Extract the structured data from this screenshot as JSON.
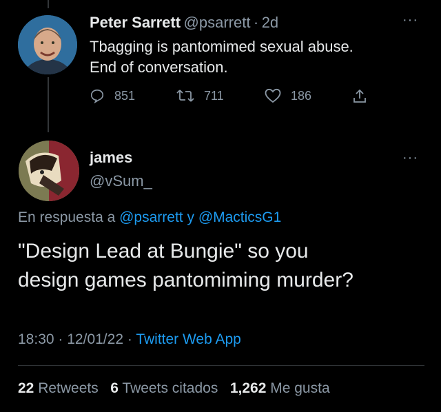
{
  "tweet1": {
    "name": "Peter Sarrett",
    "handle": "@psarrett",
    "time": "2d",
    "text_line1": "Tbagging is pantomimed sexual abuse.",
    "text_line2": "End of conversation.",
    "replies": "851",
    "retweets": "711",
    "likes": "186"
  },
  "tweet2": {
    "name": "james",
    "handle": "@vSum_",
    "reply_prefix": "En respuesta a",
    "reply_user1": "@psarrett",
    "reply_and": "y",
    "reply_user2": "@MacticsG1",
    "text_line1": "\"Design Lead at Bungie\" so you",
    "text_line2": "design games pantomiming murder?",
    "time": "18:30",
    "date": "12/01/22",
    "source": "Twitter Web App"
  },
  "stats": {
    "retweets_count": "22",
    "retweets_label": "Retweets",
    "quotes_count": "6",
    "quotes_label": "Tweets citados",
    "likes_count": "1,262",
    "likes_label": "Me gusta"
  },
  "icons": {
    "more": "more-icon",
    "reply": "reply-icon",
    "retweet": "retweet-icon",
    "like": "heart-icon",
    "share": "share-icon"
  },
  "colors": {
    "background": "#000000",
    "text": "#e7e9ea",
    "muted": "#8b98a5",
    "link": "#1d9bf0"
  }
}
